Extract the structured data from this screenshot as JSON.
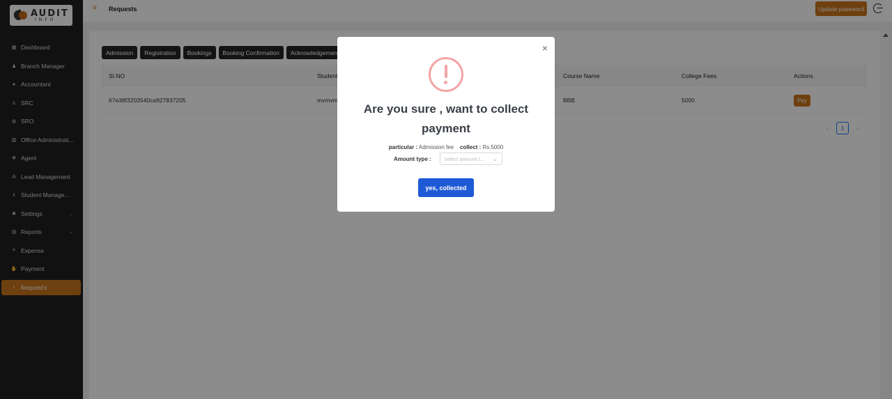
{
  "logo": {
    "line1": "AUDIT",
    "line2": "INFO"
  },
  "sidebar": {
    "items": [
      {
        "label": "Dashboard",
        "icon": "grid-icon"
      },
      {
        "label": "Branch Manager",
        "icon": "user-tie-icon"
      },
      {
        "label": "Accountant",
        "icon": "user-circle-icon"
      },
      {
        "label": "SRC",
        "icon": "user-plus-icon"
      },
      {
        "label": "SRO",
        "icon": "users-icon"
      },
      {
        "label": "Office Administrati...",
        "icon": "building-icon"
      },
      {
        "label": "Agent",
        "icon": "handshake-icon"
      },
      {
        "label": "Lead Management",
        "icon": "team-icon"
      },
      {
        "label": "Student Managem...",
        "icon": "graduate-icon"
      },
      {
        "label": "Settings",
        "icon": "gear-icon",
        "has_submenu": true
      },
      {
        "label": "Reports",
        "icon": "report-icon",
        "has_submenu": true
      },
      {
        "label": "Expense",
        "icon": "money-icon"
      },
      {
        "label": "Payment",
        "icon": "hand-coin-icon"
      },
      {
        "label": "Request's",
        "icon": "bell-icon",
        "active": true
      }
    ]
  },
  "header": {
    "title": "Requests",
    "update_password": "Update password"
  },
  "tabs": [
    "Admission",
    "Registration",
    "Bookings",
    "Booking Confirmation",
    "Acknowledgement"
  ],
  "table": {
    "headers": [
      "SI.NO",
      "Student",
      "Course Name",
      "College Fees",
      "Actions"
    ],
    "rows": [
      {
        "id": "67e38f3203540ca927837205",
        "student": "mvmvm",
        "course": "BBB",
        "fees": "5000",
        "action": "Pay"
      }
    ]
  },
  "pagination": {
    "current": "1",
    "prev": "‹",
    "next": "›"
  },
  "modal": {
    "close": "×",
    "title": "Are you sure , want to collect payment",
    "particular_label": "particular :",
    "particular_value": "Admission fee",
    "collect_label": "collect :",
    "collect_value": "Rs.5000",
    "amount_type_label": "Amount type :",
    "amount_type_placeholder": "select amount t...",
    "confirm_label": "yes, collected"
  },
  "colors": {
    "accent": "#c9761c",
    "primary": "#1f5ad6",
    "warning": "#f3a4a4",
    "sidebar_bg": "#1f1f1f"
  }
}
